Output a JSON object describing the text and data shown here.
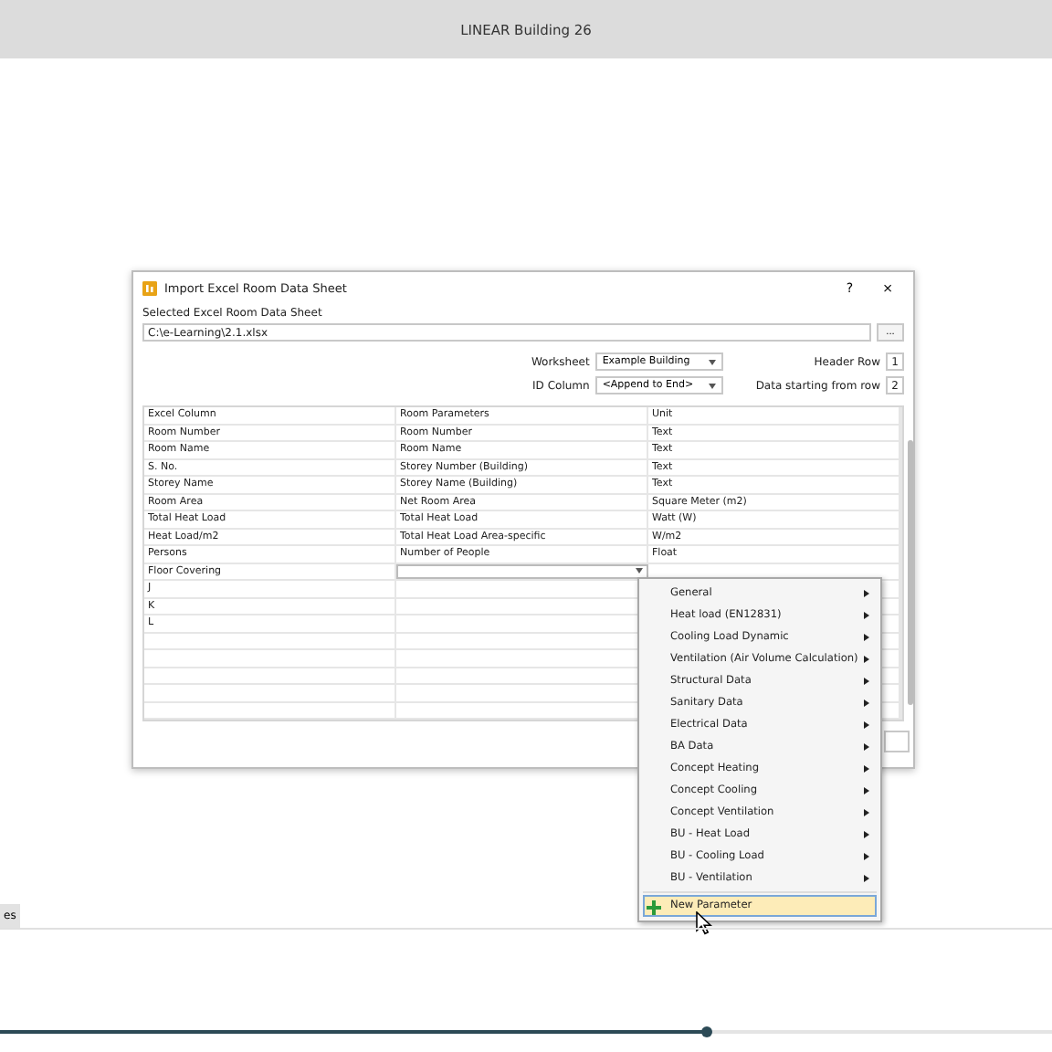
{
  "app_title": "LINEAR Building 26",
  "dialog": {
    "title": "Import Excel Room Data Sheet",
    "help": "?",
    "close": "×",
    "file_label": "Selected Excel Room Data Sheet",
    "file_path": "C:\\e-Learning\\2.1.xlsx",
    "browse": "...",
    "worksheet": {
      "label": "Worksheet",
      "value": "Example Building"
    },
    "id_column": {
      "label": "ID Column",
      "value": "<Append to End>"
    },
    "header_row": {
      "label": "Header Row",
      "value": "1"
    },
    "data_start": {
      "label": "Data starting from row",
      "value": "2"
    },
    "table": {
      "columns": [
        "Excel Column",
        "Room Parameters",
        "Unit"
      ],
      "rows": [
        {
          "excel_column": "Room Number",
          "parameter": "Room Number",
          "unit": "Text",
          "editing": false
        },
        {
          "excel_column": "Room Name",
          "parameter": "Room Name",
          "unit": "Text",
          "editing": false
        },
        {
          "excel_column": "S. No.",
          "parameter": "Storey Number (Building)",
          "unit": "Text",
          "editing": false
        },
        {
          "excel_column": "Storey Name",
          "parameter": "Storey Name (Building)",
          "unit": "Text",
          "editing": false
        },
        {
          "excel_column": "Room Area",
          "parameter": "Net Room Area",
          "unit": "Square Meter (m2)",
          "editing": false
        },
        {
          "excel_column": "Total Heat Load",
          "parameter": "Total Heat Load",
          "unit": "Watt (W)",
          "editing": false
        },
        {
          "excel_column": "Heat Load/m2",
          "parameter": "Total Heat Load Area-specific",
          "unit": "W/m2",
          "editing": false
        },
        {
          "excel_column": "Persons",
          "parameter": "Number of People",
          "unit": "Float",
          "editing": false
        },
        {
          "excel_column": "Floor Covering",
          "editing": true
        },
        {
          "excel_column": "J",
          "editing": false
        },
        {
          "excel_column": "K",
          "editing": false
        },
        {
          "excel_column": "L",
          "editing": false
        }
      ]
    }
  },
  "menu": [
    {
      "label": "General",
      "kind": "submenu",
      "selected": false
    },
    {
      "label": "Heat load (EN12831)",
      "kind": "submenu",
      "selected": false
    },
    {
      "label": "Cooling Load Dynamic",
      "kind": "submenu",
      "selected": false
    },
    {
      "label": "Ventilation (Air Volume Calculation)",
      "kind": "submenu",
      "selected": false
    },
    {
      "label": "Structural Data",
      "kind": "submenu",
      "selected": false
    },
    {
      "label": "Sanitary Data",
      "kind": "submenu",
      "selected": false
    },
    {
      "label": "Electrical Data",
      "kind": "submenu",
      "selected": false
    },
    {
      "label": "BA Data",
      "kind": "submenu",
      "selected": false
    },
    {
      "label": "Concept Heating",
      "kind": "submenu",
      "selected": false
    },
    {
      "label": "Concept Cooling",
      "kind": "submenu",
      "selected": false
    },
    {
      "label": "Concept Ventilation",
      "kind": "submenu",
      "selected": false
    },
    {
      "label": "BU - Heat Load",
      "kind": "submenu",
      "selected": false
    },
    {
      "label": "BU - Cooling Load",
      "kind": "submenu",
      "selected": false
    },
    {
      "label": "BU - Ventilation",
      "kind": "submenu",
      "selected": false
    },
    {
      "label": "New Parameter",
      "kind": "action",
      "selected": true
    }
  ],
  "side_tab": {
    "label": "es"
  },
  "progress": {
    "level": 0.672
  }
}
